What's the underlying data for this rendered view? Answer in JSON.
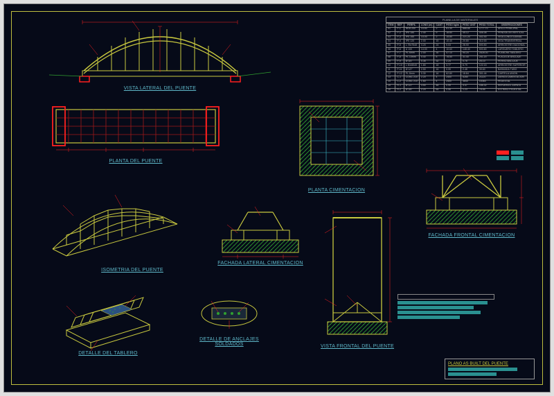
{
  "titles": {
    "lateral": "VISTA LATERAL DEL PUENTE",
    "planta": "PLANTA DEL PUENTE",
    "isometria": "ISOMETRIA DEL PUENTE",
    "tablero": "DETALLE DEL TABLERO",
    "anclajes": "DETALLE DE ANCLAJES SOLDADOS",
    "cimentacion": "PLANTA CIMENTACION",
    "fachada_lateral": "FACHADA LATERAL CIMENTACION",
    "fachada_frontal": "FACHADA FRONTAL CIMENTACION",
    "frontal": "VISTA FRONTAL DEL PUENTE",
    "plano": "PLANO AS BUILT DEL PUENTE"
  },
  "colors": {
    "bg": "#060a18",
    "frame": "#bfbf3f",
    "title": "#5fb8c9",
    "yellow": "#c9c93f",
    "red": "#ff2020",
    "green": "#30a030",
    "magenta": "#d040d0",
    "cyan": "#40c0d0",
    "teal": "#2a9090"
  },
  "chart_data": {
    "type": "table",
    "title": "PLANILLA DE MATERIALES",
    "columns": [
      "ITEM",
      "REF",
      "PERFIL",
      "LONG (m)",
      "CANT",
      "PESO kg/m",
      "PESO UNIT",
      "PESO TOTAL",
      "OBSERVACIONES"
    ],
    "rows": [
      [
        "01",
        "P-1",
        "HEB 200",
        "14.50",
        "2",
        "61.30",
        "888.85",
        "1777.70",
        "ARCO PRINCIPAL"
      ],
      [
        "02",
        "P-2",
        "IPE 180",
        "2.40",
        "9",
        "18.80",
        "45.12",
        "406.08",
        "PENDOLON VERTICAL"
      ],
      [
        "03",
        "P-3",
        "IPE 160",
        "14.00",
        "2",
        "15.80",
        "221.20",
        "442.40",
        "VIGA LONGITUDINAL"
      ],
      [
        "04",
        "P-4",
        "IPE 120",
        "2.00",
        "15",
        "10.40",
        "20.80",
        "312.00",
        "VIGA TRANSVERSAL"
      ],
      [
        "05",
        "P-5",
        "L 75x75x8",
        "3.20",
        "24",
        "9.03",
        "28.90",
        "693.50",
        "ARRIOSTRE DIAGONAL"
      ],
      [
        "06",
        "P-6",
        "U 100",
        "14.00",
        "4",
        "10.60",
        "148.40",
        "593.60",
        "LARGUERO TABLERO"
      ],
      [
        "07",
        "P-7",
        "PL 6mm",
        "2.00",
        "30",
        "47.10",
        "94.20",
        "2826.00",
        "PLANCHA TABLERO"
      ],
      [
        "08",
        "P-8",
        "PL 10mm",
        "0.40",
        "8",
        "78.50",
        "31.40",
        "251.20",
        "PLACA DE ANCLAJE"
      ],
      [
        "09",
        "P-9",
        "Ø 3/4\"",
        "0.35",
        "32",
        "2.24",
        "0.78",
        "25.10",
        "PERNO ANCLAJE"
      ],
      [
        "10",
        "P-10",
        "L 50x50x5",
        "1.80",
        "18",
        "3.77",
        "6.79",
        "122.15",
        "ARRIOSTRE SUPERIOR"
      ],
      [
        "11",
        "P-11",
        "Ø 1/2\"",
        "2.50",
        "16",
        "0.99",
        "2.48",
        "39.60",
        "BARANDA TUBO"
      ],
      [
        "12",
        "P-12",
        "PL 8mm",
        "0.30",
        "16",
        "62.80",
        "18.84",
        "301.44",
        "CARTELA UNION"
      ],
      [
        "13",
        "C-1",
        "CONC 210",
        "2.20",
        "4",
        "2400",
        "5280",
        "21120",
        "ZAPATA CIMENTACION"
      ],
      [
        "14",
        "C-2",
        "CONC 210",
        "1.60",
        "4",
        "2400",
        "3840",
        "15360",
        "PEDESTAL"
      ],
      [
        "15",
        "R-1",
        "Ø 1/2\"",
        "3.50",
        "48",
        "0.99",
        "3.47",
        "166.32",
        "REFUERZO ZAPATA"
      ],
      [
        "16",
        "R-2",
        "Ø 3/8\"",
        "2.20",
        "64",
        "0.56",
        "1.23",
        "78.85",
        "ESTRIBO PEDESTAL"
      ]
    ]
  },
  "legend": [
    {
      "label": "",
      "color": "#ff2020"
    },
    {
      "label": "",
      "color": "#2a9090"
    },
    {
      "label": "",
      "color": "#2a9090"
    }
  ]
}
